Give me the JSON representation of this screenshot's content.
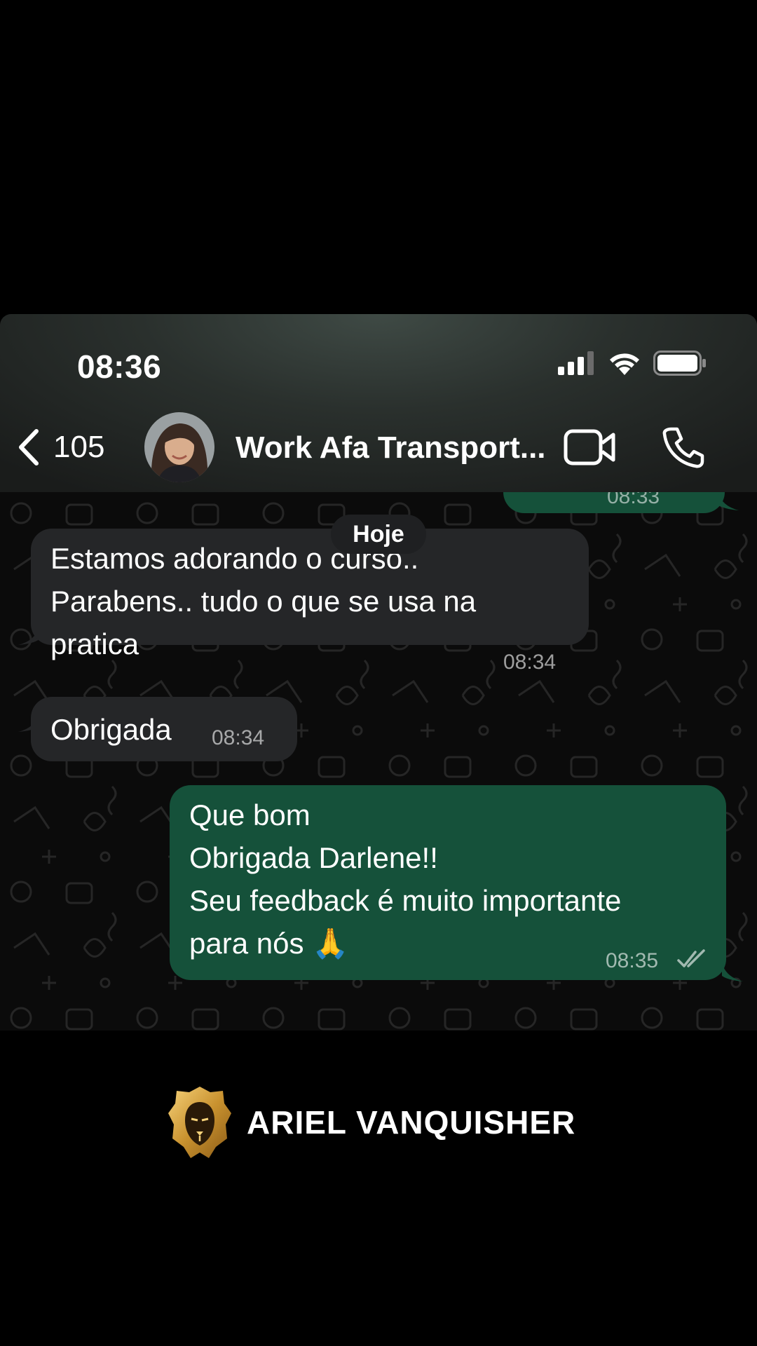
{
  "status_bar": {
    "time": "08:36"
  },
  "header": {
    "back_count": "105",
    "contact_name": "Work Afa Transport...",
    "icons": [
      "chevron-left-icon",
      "video-call-icon",
      "phone-icon"
    ]
  },
  "chat": {
    "previous_time": "08:33",
    "date_label": "Hoje",
    "messages": [
      {
        "direction": "in",
        "text": "Estamos adorando o curso..\nParabens.. tudo o que se usa na\npratica",
        "time": "08:34"
      },
      {
        "direction": "in",
        "text": "Obrigada",
        "time": "08:34"
      },
      {
        "direction": "out",
        "text": "Que bom\nObrigada Darlene!!\nSeu feedback é muito importante\npara nós 🙏",
        "time": "08:35",
        "status": "read"
      }
    ]
  },
  "brand": {
    "name": "ARIEL VANQUISHER"
  },
  "colors": {
    "incoming_bubble": "#252628",
    "outgoing_bubble": "#15513a",
    "background": "#000000"
  }
}
